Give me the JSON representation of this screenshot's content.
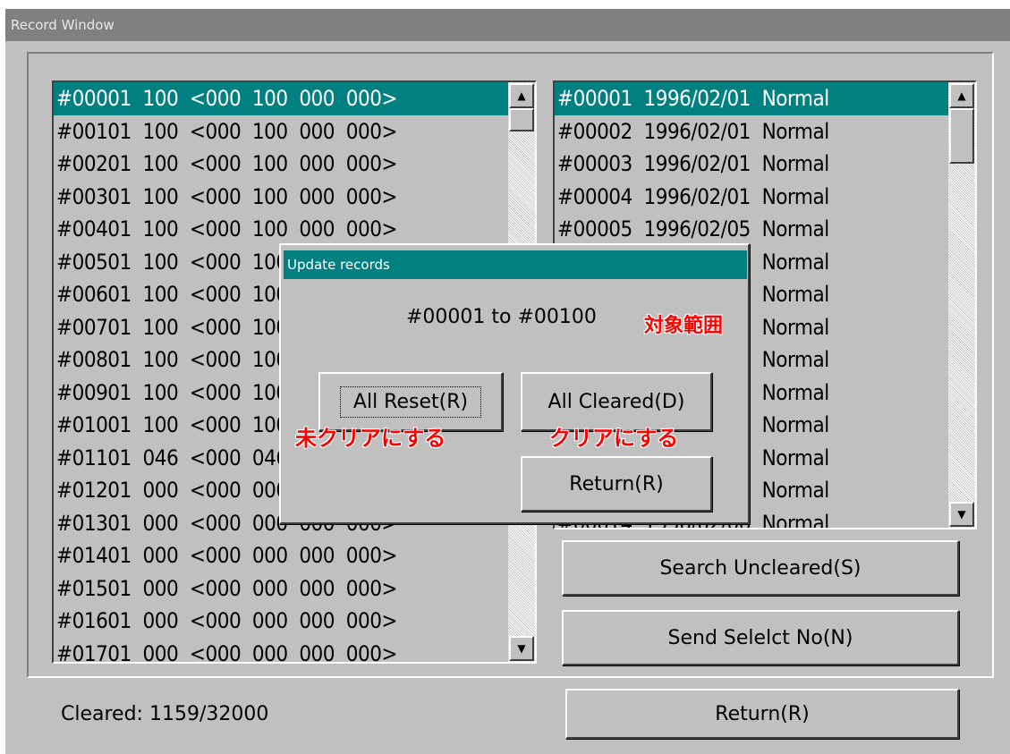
{
  "window": {
    "title": "Record Window"
  },
  "left_list": {
    "rows": [
      "#00001  100  <000  100  000  000>",
      "#00101  100  <000  100  000  000>",
      "#00201  100  <000  100  000  000>",
      "#00301  100  <000  100  000  000>",
      "#00401  100  <000  100  000  000>",
      "#00501  100  <000  100  000  000>",
      "#00601  100  <000  100  000  000>",
      "#00701  100  <000  100  000  000>",
      "#00801  100  <000  100  000  000>",
      "#00901  100  <000  100  000  000>",
      "#01001  100  <000  100  000  000>",
      "#01101  046  <000  046  000  000>",
      "#01201  000  <000  000  000  000>",
      "#01301  000  <000  000  000  000>",
      "#01401  000  <000  000  000  000>",
      "#01501  000  <000  000  000  000>",
      "#01601  000  <000  000  000  000>",
      "#01701  000  <000  000  000  000>"
    ],
    "selected_index": 0
  },
  "right_list": {
    "rows": [
      "#00001  1996/02/01  Normal",
      "#00002  1996/02/01  Normal",
      "#00003  1996/02/01  Normal",
      "#00004  1996/02/01  Normal",
      "#00005  1996/02/05  Normal",
      "#00006  1996/02/05  Normal",
      "#00007  1996/02/06  Normal",
      "#00008  1996/02/06  Normal",
      "#00009  1996/02/06  Normal",
      "#00010  1996/02/06  Normal",
      "#00011  1996/02/06  Normal",
      "#00012  1996/02/06  Normal",
      "#00013  1996/02/06  Normal",
      "#00014  1996/02/06  Normal"
    ],
    "selected_index": 0
  },
  "buttons": {
    "search_uncleared": "Search Uncleared(S)",
    "send_select_no": "Send Selelct No(N)",
    "return": "Return(R)"
  },
  "status": {
    "cleared": "Cleared:  1159/32000"
  },
  "dialog": {
    "title": "Update records",
    "range": "#00001  to  #00100",
    "all_reset": "All Reset(R)",
    "all_cleared": "All Cleared(D)",
    "return": "Return(R)"
  },
  "annotations": {
    "range": "対象範囲",
    "all_reset": "未クリアにする",
    "all_cleared": "クリアにする"
  },
  "colors": {
    "face": "#c0c0c0",
    "selection": "#008080",
    "annotation": "#ff0000",
    "titlebar_inactive": "#808080"
  },
  "icons": [
    "scroll-up-arrow-icon",
    "scroll-down-arrow-icon"
  ]
}
